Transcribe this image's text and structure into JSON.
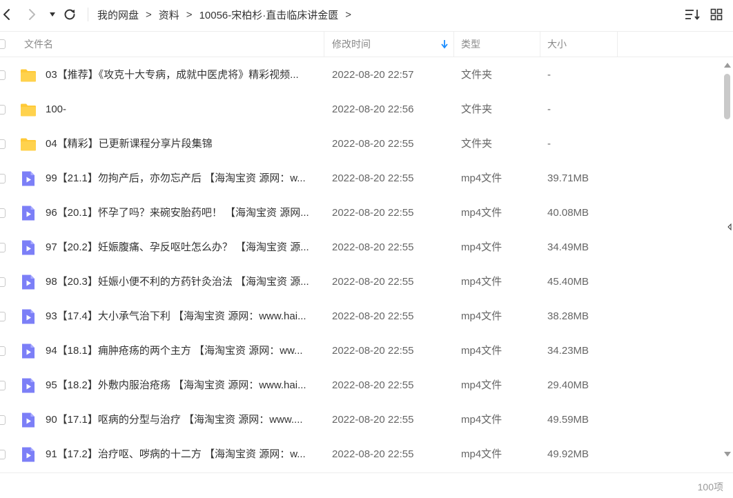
{
  "breadcrumb": {
    "items": [
      "我的网盘",
      "资料",
      "10056-宋柏杉·直击临床讲金匮"
    ],
    "separator": ">"
  },
  "header": {
    "name": "文件名",
    "modified": "修改时间",
    "type": "类型",
    "size": "大小",
    "sort_color": "#1a8cff"
  },
  "icons": {
    "back": "chevron-left-icon",
    "forward": "chevron-right-icon",
    "history": "caret-down-icon",
    "refresh": "refresh-icon",
    "sort": "sort-list-icon",
    "grid": "grid-view-icon",
    "folder_color": "#ffc937",
    "video_color": "#7c7ff7"
  },
  "files": [
    {
      "kind": "folder",
      "name": "03【推荐】《攻克十大专病，成就中医虎将》精彩视频...",
      "date": "2022-08-20 22:57",
      "type": "文件夹",
      "size": "-"
    },
    {
      "kind": "folder",
      "name": "100-",
      "date": "2022-08-20 22:56",
      "type": "文件夹",
      "size": "-"
    },
    {
      "kind": "folder",
      "name": "04【精彩】已更新课程分享片段集锦",
      "date": "2022-08-20 22:55",
      "type": "文件夹",
      "size": "-"
    },
    {
      "kind": "video",
      "name": "99【21.1】勿拘产后，亦勿忘产后 【海淘宝资 源网：w...",
      "date": "2022-08-20 22:55",
      "type": "mp4文件",
      "size": "39.71MB"
    },
    {
      "kind": "video",
      "name": "96【20.1】怀孕了吗？来碗安胎药吧！ 【海淘宝资 源网...",
      "date": "2022-08-20 22:55",
      "type": "mp4文件",
      "size": "40.08MB"
    },
    {
      "kind": "video",
      "name": "97【20.2】妊娠腹痛、孕反呕吐怎么办？ 【海淘宝资 源...",
      "date": "2022-08-20 22:55",
      "type": "mp4文件",
      "size": "34.49MB"
    },
    {
      "kind": "video",
      "name": "98【20.3】妊娠小便不利的方药针灸治法 【海淘宝资 源...",
      "date": "2022-08-20 22:55",
      "type": "mp4文件",
      "size": "45.40MB"
    },
    {
      "kind": "video",
      "name": "93【17.4】大小承气治下利 【海淘宝资 源网：www.hai...",
      "date": "2022-08-20 22:55",
      "type": "mp4文件",
      "size": "38.28MB"
    },
    {
      "kind": "video",
      "name": "94【18.1】痈肿疮疡的两个主方 【海淘宝资 源网：ww...",
      "date": "2022-08-20 22:55",
      "type": "mp4文件",
      "size": "34.23MB"
    },
    {
      "kind": "video",
      "name": "95【18.2】外敷内服治疮疡 【海淘宝资 源网：www.hai...",
      "date": "2022-08-20 22:55",
      "type": "mp4文件",
      "size": "29.40MB"
    },
    {
      "kind": "video",
      "name": "90【17.1】呕病的分型与治疗 【海淘宝资 源网：www....",
      "date": "2022-08-20 22:55",
      "type": "mp4文件",
      "size": "49.59MB"
    },
    {
      "kind": "video",
      "name": "91【17.2】治疗呕、哕病的十二方 【海淘宝资 源网：w...",
      "date": "2022-08-20 22:55",
      "type": "mp4文件",
      "size": "49.92MB"
    }
  ],
  "footer": {
    "count": "100项"
  }
}
